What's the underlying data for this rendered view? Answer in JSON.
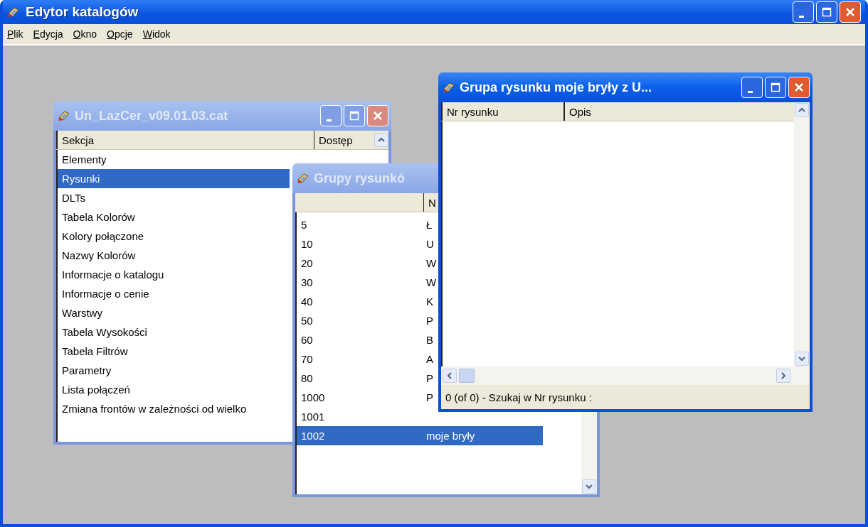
{
  "window": {
    "title": "Edytor katalogów",
    "active": true
  },
  "menu": [
    "Plik",
    "Edycja",
    "Okno",
    "Opcje",
    "Widok"
  ],
  "catalog_window": {
    "title": "Un_LazCer_v09.01.03.cat",
    "active": false,
    "columns": [
      "Sekcja",
      "Dostęp"
    ],
    "rows": [
      {
        "label": "Elementy",
        "selected": false
      },
      {
        "label": "Rysunki",
        "selected": true
      },
      {
        "label": "DLTs",
        "selected": false
      },
      {
        "label": "Tabela Kolorów",
        "selected": false
      },
      {
        "label": "Kolory połączone",
        "selected": false
      },
      {
        "label": "Nazwy Kolorów",
        "selected": false
      },
      {
        "label": "Informacje o katalogu",
        "selected": false
      },
      {
        "label": "Informacje o cenie",
        "selected": false
      },
      {
        "label": "Warstwy",
        "selected": false
      },
      {
        "label": "Tabela Wysokości",
        "selected": false
      },
      {
        "label": "Tabela Filtrów",
        "selected": false
      },
      {
        "label": "Parametry",
        "selected": false
      },
      {
        "label": "Lista połączeń",
        "selected": false
      },
      {
        "label": "Zmiana frontów w zależności od wielko",
        "selected": false
      }
    ]
  },
  "groups_window": {
    "title": "Grupy rysunkó",
    "active": false,
    "column_2_header": "N",
    "rows": [
      {
        "number": "5",
        "name": "Ł",
        "selected": false
      },
      {
        "number": "10",
        "name": "U",
        "selected": false
      },
      {
        "number": "20",
        "name": "W",
        "selected": false
      },
      {
        "number": "30",
        "name": "W",
        "selected": false
      },
      {
        "number": "40",
        "name": "K",
        "selected": false
      },
      {
        "number": "50",
        "name": "P",
        "selected": false
      },
      {
        "number": "60",
        "name": "B",
        "selected": false
      },
      {
        "number": "70",
        "name": "A",
        "selected": false
      },
      {
        "number": "80",
        "name": "P",
        "selected": false
      },
      {
        "number": "1000",
        "name": "P",
        "selected": false
      },
      {
        "number": "1001",
        "selected": false
      },
      {
        "number": "1002",
        "name": "moje bryły",
        "selected": true
      }
    ]
  },
  "drawing_group_window": {
    "title": "Grupa rysunku moje bryły z U...",
    "active": true,
    "columns": [
      "Nr rysunku",
      "Opis"
    ],
    "status": "0 (of 0) - Szukaj w Nr rysunku :"
  }
}
